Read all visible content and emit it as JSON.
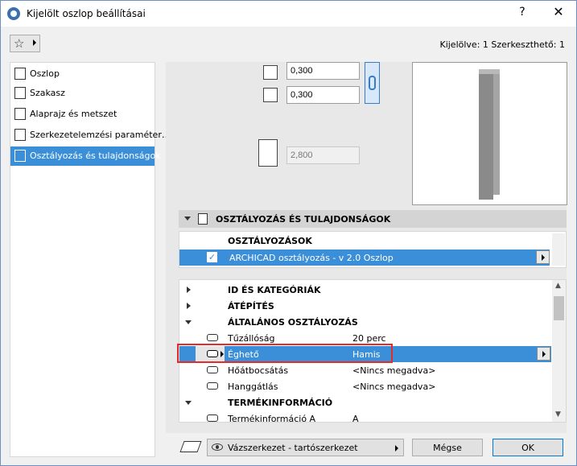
{
  "window": {
    "title": "Kijelölt oszlop beállításai",
    "help_label": "?",
    "close_label": "✕"
  },
  "toolbar": {
    "favorites_icon": "star-icon",
    "selection_info": "Kijelölve: 1 Szerkeszthető: 1"
  },
  "sidebar": {
    "items": [
      {
        "label": "Oszlop",
        "icon": "column-icon",
        "active": false
      },
      {
        "label": "Szakasz",
        "icon": "segment-icon",
        "active": false
      },
      {
        "label": "Alaprajz és metszet",
        "icon": "floorplan-icon",
        "active": false
      },
      {
        "label": "Szerkezetelemzési paraméter…",
        "icon": "structural-icon",
        "active": false
      },
      {
        "label": "Osztályozás és tulajdonságok",
        "icon": "classification-icon",
        "active": true
      }
    ]
  },
  "geometry": {
    "width_value": "0,300",
    "depth_value": "0,300",
    "height_value": "2,800"
  },
  "section": {
    "title": "OSZTÁLYOZÁS ÉS TULAJDONSÁGOK",
    "classifications_title": "OSZTÁLYOZÁSOK",
    "classification_entry": "ARCHICAD osztályozás - v 2.0 Oszlop",
    "classification_checked": "✓"
  },
  "properties": {
    "groups": {
      "id": "ID ÉS KATEGÓRIÁK",
      "renovation": "ÁTÉPÍTÉS",
      "general": "ÁLTALÁNOS OSZTÁLYOZÁS",
      "product": "TERMÉKINFORMÁCIÓ"
    },
    "rows": [
      {
        "name": "Tűzállóság",
        "value": "20 perc"
      },
      {
        "name": "Éghető",
        "value": "Hamis"
      },
      {
        "name": "Hőátbocsátás",
        "value": "<Nincs megadva>"
      },
      {
        "name": "Hanggátlás",
        "value": "<Nincs megadva>"
      }
    ],
    "product_row": {
      "name": "Termékinformáció A",
      "value": "A"
    }
  },
  "footer": {
    "layer_label": "Vázszerkezet - tartószerkezet",
    "cancel_label": "Mégse",
    "ok_label": "OK"
  }
}
